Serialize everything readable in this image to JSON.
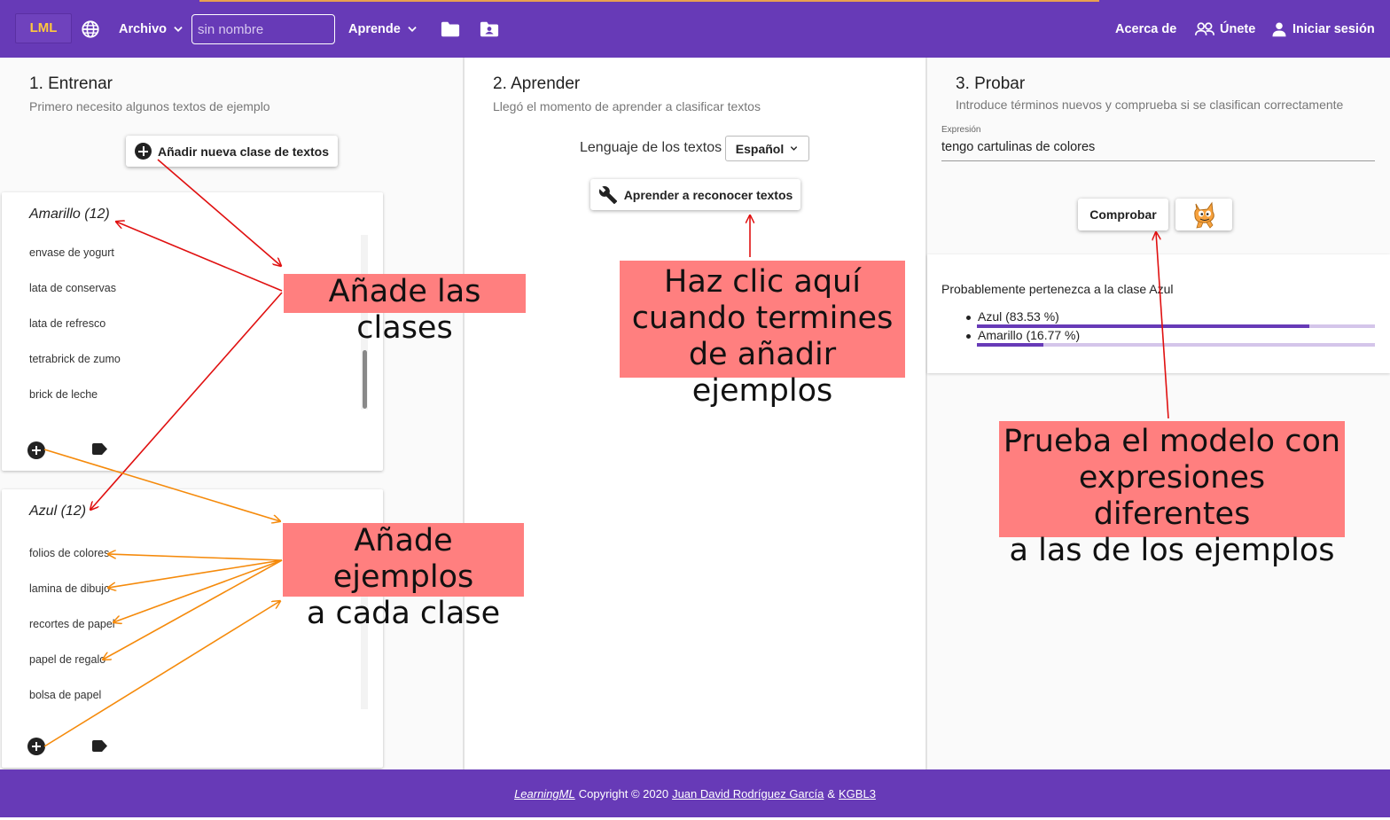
{
  "topbar": {
    "logo": "LML",
    "archivo_label": "Archivo",
    "name_placeholder": "sin nombre",
    "aprende_label": "Aprende",
    "acerca_label": "Acerca de",
    "unete_label": "Únete",
    "login_label": "Iniciar sesión",
    "bg_color": "#673ab7",
    "logo_color": "#ffc83d"
  },
  "train": {
    "title": "1. Entrenar",
    "subtitle": "Primero necesito algunos textos de ejemplo",
    "add_class_button": "Añadir nueva clase de textos",
    "classes": [
      {
        "title": "Amarillo (12)",
        "items": [
          "envase de yogurt",
          "lata de conservas",
          "lata de refresco",
          "tetrabrick de zumo",
          "brick de leche"
        ]
      },
      {
        "title": "Azul (12)",
        "items": [
          "folios de colores",
          "lamina de dibujo",
          "recortes de papel",
          "papel de regalo",
          "bolsa de papel"
        ]
      }
    ],
    "tag_suffix": "_"
  },
  "learn": {
    "title": "2. Aprender",
    "subtitle": "Llegó el momento de aprender a clasificar textos",
    "language_label": "Lenguaje de los textos",
    "language_value": "Español",
    "learn_button": "Aprender a reconocer textos"
  },
  "test": {
    "title": "3. Probar",
    "subtitle": "Introduce términos nuevos y comprueba si se clasifican correctamente",
    "expression_label": "Expresión",
    "expression_value": "tengo cartulinas de colores",
    "check_button": "Comprobar",
    "result_heading": "Probablemente pertenezca a la clase Azul",
    "results": [
      {
        "label": "Azul (83.53 %)",
        "value": 0.8353
      },
      {
        "label": "Amarillo (16.77 %)",
        "value": 0.1677
      }
    ]
  },
  "callouts": {
    "add_classes": "Añade las clases",
    "add_examples_1": "Añade ejemplos",
    "add_examples_2": "a cada clase",
    "click_here_1": "Haz clic aquí",
    "click_here_2": "cuando termines",
    "click_here_3": "de añadir ejemplos",
    "test_model_1": "Prueba el modelo con",
    "test_model_2": "expresiones diferentes",
    "test_model_3": "a las de los ejemplos",
    "color": "#ff7f7f"
  },
  "footer": {
    "brand": "LearningML",
    "copyright": "Copyright © 2020",
    "author": "Juan David Rodríguez García",
    "amp": "&",
    "group": "KGBL3"
  }
}
